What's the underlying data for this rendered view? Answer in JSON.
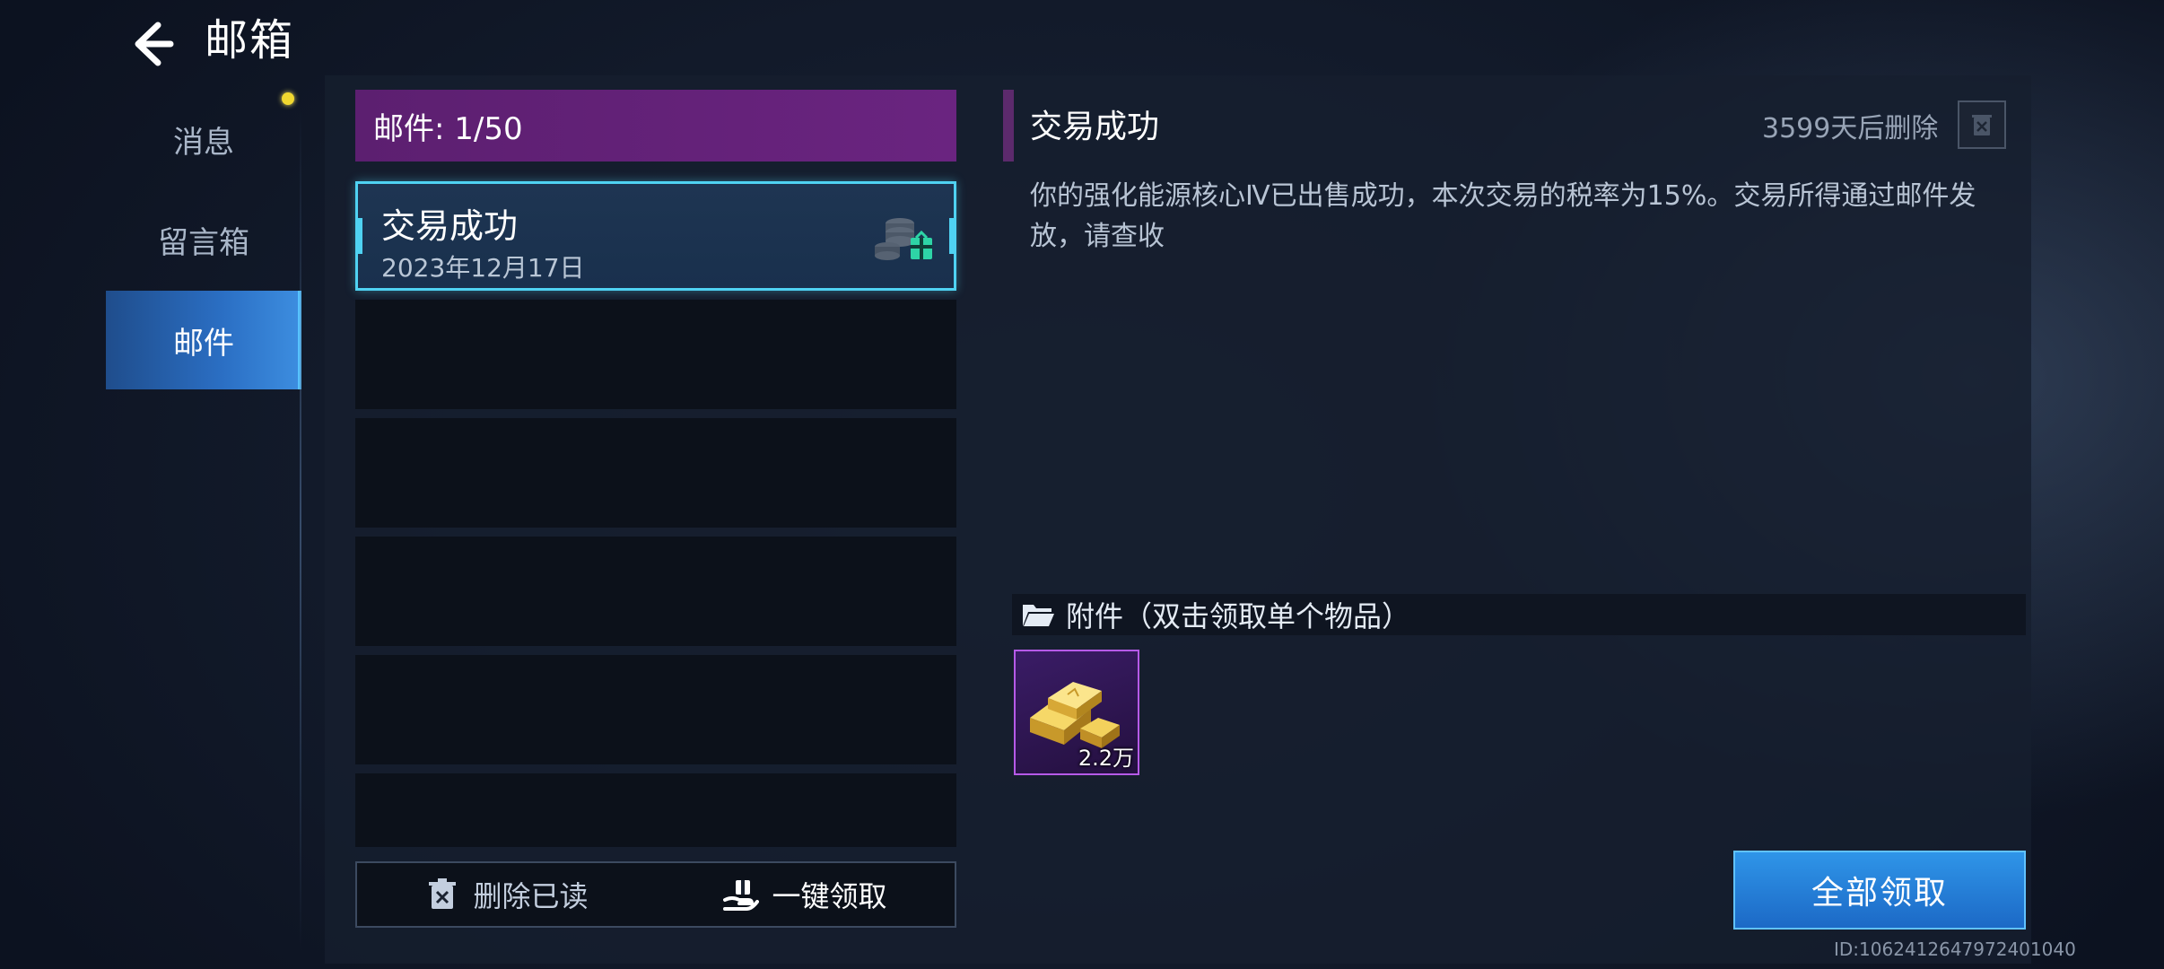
{
  "header": {
    "title": "邮箱"
  },
  "nav": {
    "items": [
      {
        "label": "消息"
      },
      {
        "label": "留言箱"
      },
      {
        "label": "邮件"
      }
    ]
  },
  "mail_list": {
    "header": "邮件: 1/50",
    "items": [
      {
        "title": "交易成功",
        "date": "2023年12月17日"
      }
    ],
    "footer": {
      "delete_read": "删除已读",
      "claim_one_key": "一键领取"
    }
  },
  "detail": {
    "title": "交易成功",
    "expire": "3599天后删除",
    "body": "你的强化能源核心Ⅳ已出售成功，本次交易的税率为15%。交易所得通过邮件发放，请查收",
    "attachments_label": "附件（双击领取单个物品）",
    "attachments": [
      {
        "icon": "gold-bar-icon",
        "quantity": "2.2万"
      }
    ]
  },
  "claim_all": "全部领取",
  "user_id": "ID:1062412647972401040",
  "colors": {
    "accent_cyan": "#4fd2f2",
    "header_purple": "#5c1f70",
    "button_blue": "#2f95e8",
    "notice_dot": "#f0d830"
  }
}
